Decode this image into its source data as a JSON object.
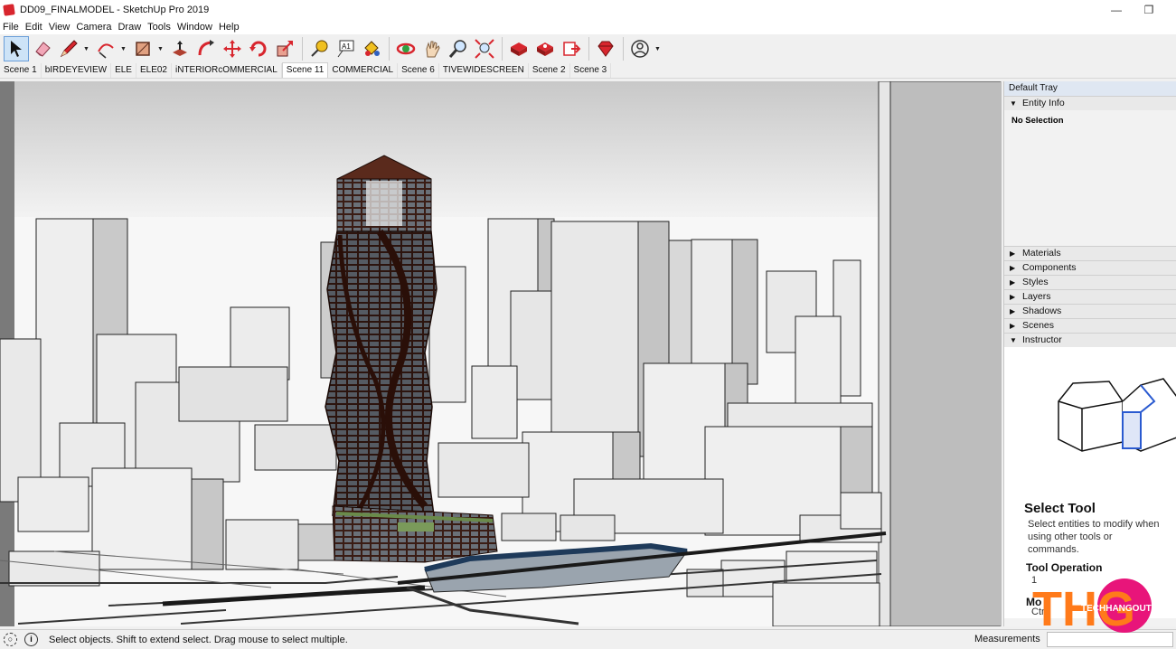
{
  "window": {
    "title": "DD09_FINALMODEL - SketchUp Pro 2019",
    "minimize_glyph": "—",
    "restore_glyph": "❐"
  },
  "menu": [
    "File",
    "Edit",
    "View",
    "Camera",
    "Draw",
    "Tools",
    "Window",
    "Help"
  ],
  "toolbar": {
    "tools": [
      {
        "icon": "select-arrow-icon",
        "active": true
      },
      {
        "icon": "eraser-icon"
      },
      {
        "icon": "pencil-line-icon",
        "dropdown": true
      },
      {
        "icon": "arc-icon",
        "dropdown": true
      },
      {
        "icon": "rectangle-icon",
        "dropdown": true
      },
      {
        "icon": "push-pull-icon"
      },
      {
        "icon": "follow-me-icon"
      },
      {
        "icon": "move-icon"
      },
      {
        "icon": "rotate-icon"
      },
      {
        "icon": "scale-icon"
      },
      {
        "icon": "tape-measure-icon"
      },
      {
        "icon": "text-icon"
      },
      {
        "icon": "paint-bucket-icon"
      },
      {
        "icon": "orbit-icon"
      },
      {
        "icon": "pan-icon"
      },
      {
        "icon": "zoom-icon"
      },
      {
        "icon": "zoom-extents-icon"
      },
      {
        "icon": "3d-warehouse-icon"
      },
      {
        "icon": "extension-warehouse-icon"
      },
      {
        "icon": "layout-send-icon"
      },
      {
        "icon": "extension-manager-icon"
      },
      {
        "icon": "account-icon",
        "dropdown": true
      }
    ]
  },
  "scenes": {
    "tabs": [
      "Scene 1",
      "bIRDEYEVIEW",
      "ELE",
      "ELE02",
      "iNTERIORcOMMERCIAL",
      "Scene 11",
      "COMMERCIAL",
      "Scene 6",
      "TIVEWIDESCREEN",
      "Scene 2",
      "Scene 3"
    ],
    "active_index": 5
  },
  "tray": {
    "title": "Default Tray",
    "entity_info": {
      "label": "Entity Info",
      "expanded": true,
      "selection": "No Selection"
    },
    "panels": [
      {
        "label": "Materials",
        "expanded": false
      },
      {
        "label": "Components",
        "expanded": false
      },
      {
        "label": "Styles",
        "expanded": false
      },
      {
        "label": "Layers",
        "expanded": false
      },
      {
        "label": "Shadows",
        "expanded": false
      },
      {
        "label": "Scenes",
        "expanded": false
      },
      {
        "label": "Instructor",
        "expanded": true
      }
    ],
    "instructor": {
      "tool_name": "Select Tool",
      "description": "Select entities to modify when using other tools or commands.",
      "operation_heading": "Tool Operation",
      "operation_first": "1",
      "modifier_heading": "Mo",
      "modifier_first": "Ctrl"
    }
  },
  "status": {
    "info_glyph": "i",
    "message": "Select objects. Shift to extend select. Drag mouse to select multiple.",
    "measurements_label": "Measurements",
    "measurements_value": ""
  },
  "watermark": {
    "letters": "THG",
    "brand": "TECHHANGOUT"
  },
  "colors": {
    "tower_dark": "#3a1c14",
    "tower_glass": "#5a6068",
    "sky_top": "#d8d8d8",
    "building_face": "#e8e8e8",
    "building_side": "#c8c8c8",
    "accent_red": "#d8262e",
    "watermark_pink": "#e8157a",
    "watermark_orange": "#ff7a1a"
  }
}
